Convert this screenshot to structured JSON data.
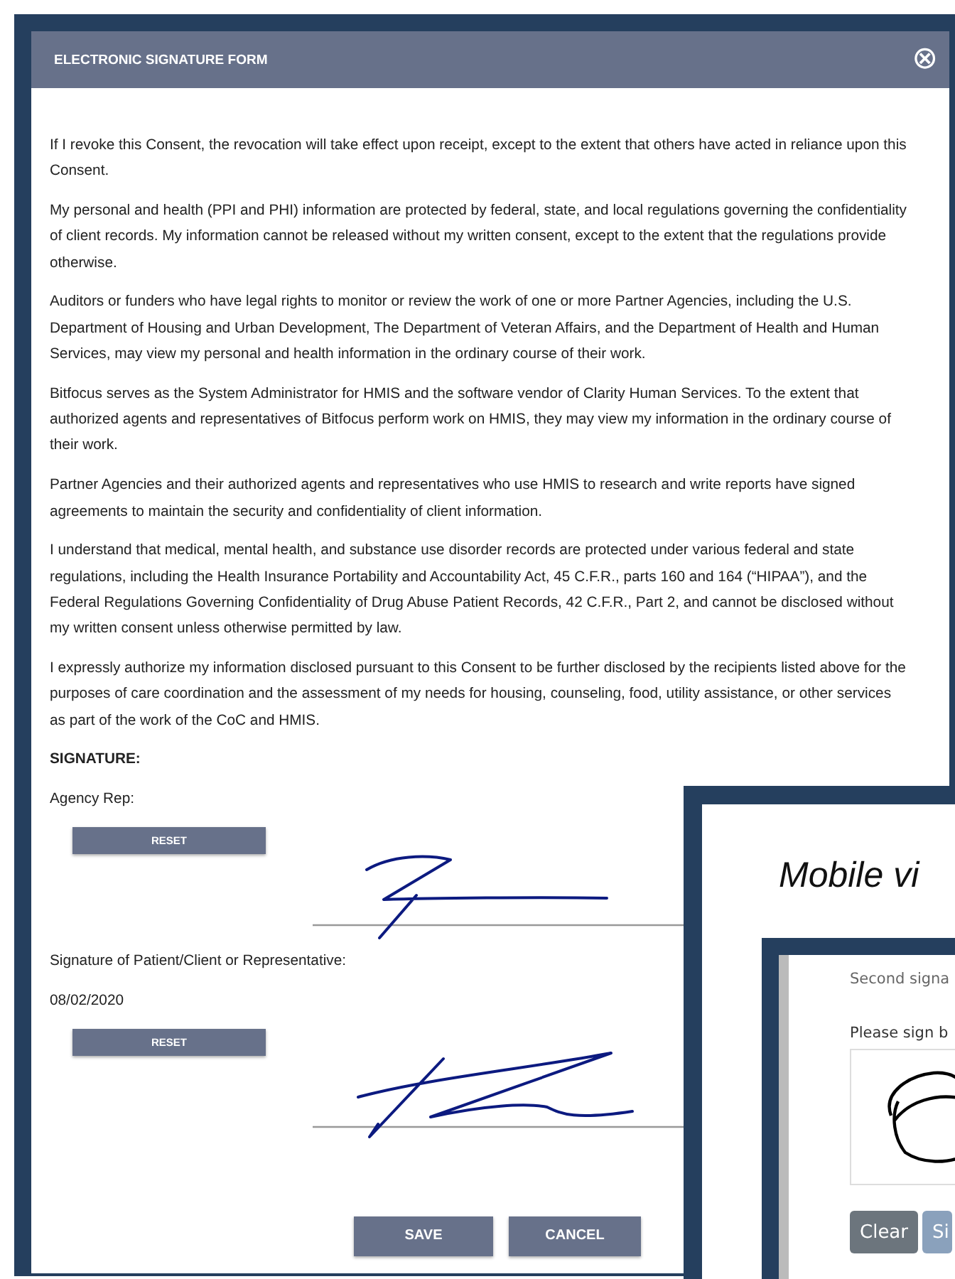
{
  "dialog": {
    "title": "ELECTRONIC SIGNATURE FORM",
    "close_icon": "⊗",
    "paragraphs": [
      "If I revoke this Consent, the revocation will take effect upon receipt, except to the extent that others have acted in reliance upon this Consent.",
      "My personal and health (PPI and PHI) information are protected by federal, state, and local regulations governing the confidentiality of client records. My information cannot be released without my written consent, except to the extent that the regulations provide otherwise.",
      "Auditors or funders who have legal rights to monitor or review the work of one or more Partner Agencies, including the U.S. Department of Housing and Urban Development, The Department of Veteran Affairs, and the Department of Health and Human Services, may view my personal and health information in the ordinary course of their work.",
      "Bitfocus serves as the System Administrator for HMIS and the software vendor of Clarity Human Services. To the extent that authorized agents and representatives of Bitfocus perform work on HMIS, they may view my information in the ordinary course of their work.",
      "Partner Agencies and their authorized agents and representatives who use HMIS to research and write reports have signed agreements to maintain the security and confidentiality of client information.",
      "I understand that medical, mental health, and substance use disorder records are protected under various federal and state regulations, including the Health Insurance Portability and Accountability Act, 45 C.F.R., parts 160 and 164 (“HIPAA”), and the Federal Regulations Governing Confidentiality of Drug Abuse Patient Records, 42 C.F.R., Part 2, and cannot be disclosed without my written consent unless otherwise permitted by law.",
      "I expressly authorize my information disclosed pursuant to this Consent to be further disclosed by the recipients listed above for the purposes of care coordination and the assessment of my needs for housing, counseling, food, utility assistance, or other services as part of the work of the CoC and HMIS."
    ],
    "signature_heading": "SIGNATURE:",
    "signatures": [
      {
        "label": "Agency Rep:",
        "reset_button": "RESET"
      },
      {
        "label": "Signature of Patient/Client or Representative:",
        "date": "08/02/2020",
        "reset_button": "RESET"
      }
    ],
    "buttons": [
      "SAVE",
      "CANCEL"
    ]
  },
  "mobile_view": {
    "caption": "Mobile vi",
    "prompt": "Second signa",
    "instruction": "Please sign b",
    "buttons": [
      {
        "label": "Clear",
        "kind": "secondary"
      },
      {
        "label": "Si",
        "kind": "primary"
      }
    ]
  }
}
